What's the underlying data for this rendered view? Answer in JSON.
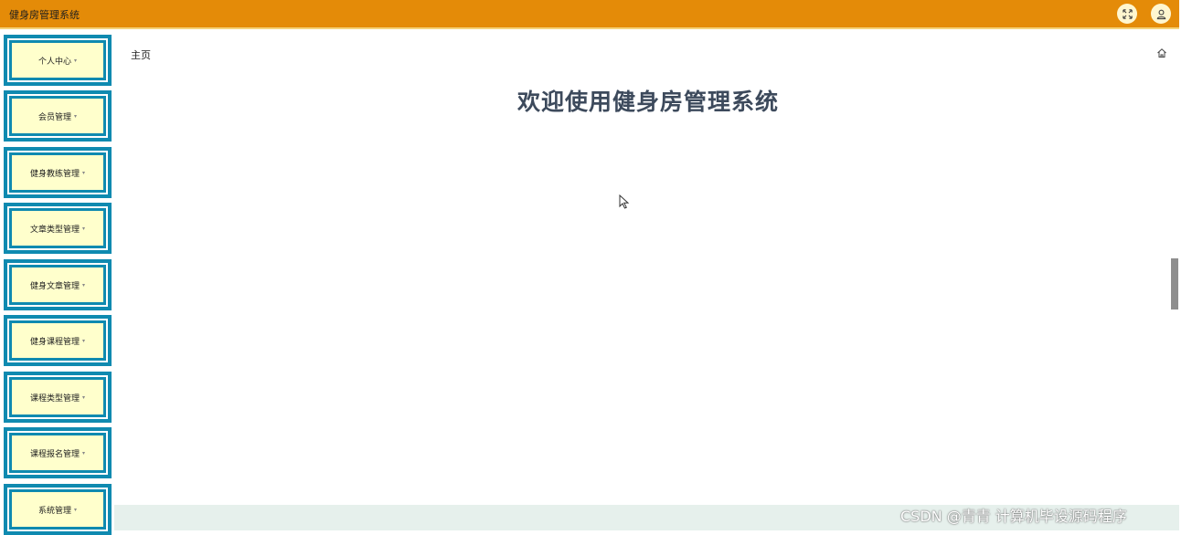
{
  "header": {
    "title": "健身房管理系统",
    "fullscreen_icon": "expand-icon",
    "user_icon": "user-icon",
    "bg_color": "#e48b08"
  },
  "sidebar": {
    "items": [
      {
        "label": "个人中心"
      },
      {
        "label": "会员管理"
      },
      {
        "label": "健身教练管理"
      },
      {
        "label": "文章类型管理"
      },
      {
        "label": "健身文章管理"
      },
      {
        "label": "健身课程管理"
      },
      {
        "label": "课程类型管理"
      },
      {
        "label": "课程报名管理"
      },
      {
        "label": "系统管理"
      }
    ],
    "caret": "▾",
    "border_color": "#0f8ab0",
    "item_bg": "#ffffcc"
  },
  "main": {
    "breadcrumb": "主页",
    "home_icon": "home-icon",
    "welcome": "欢迎使用健身房管理系统"
  },
  "watermark": "CSDN @青青 计算机毕设源码程序"
}
